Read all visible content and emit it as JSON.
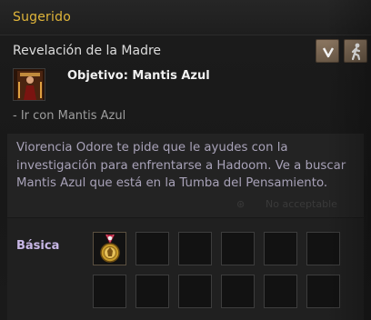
{
  "header": {
    "title": "Sugerido"
  },
  "quest": {
    "title": "Revelación de la Madre",
    "objective": "Objetivo: Mantis Azul",
    "subobjective": "- Ir con Mantis Azul",
    "description": "Viorencia Odore te pide que le ayudes con la investigación para enfrentarse a Hadoom. Ve a buscar Mantis Azul que está en la Tumba del Pensamiento."
  },
  "background_text": {
    "faded_hint": "No acceptable"
  },
  "rewards": {
    "label": "Básica",
    "slot_count": 12,
    "items": [
      {
        "icon": "medal-icon",
        "slot": 0
      }
    ]
  },
  "buttons": {
    "filter_icon": "chevron-down-icon",
    "navigate_icon": "walking-person-icon"
  },
  "colors": {
    "header_title": "#e0b53a",
    "reward_label": "#c8b7e6",
    "description_text": "#a8a2b8",
    "button_bg": "#7a6752"
  }
}
